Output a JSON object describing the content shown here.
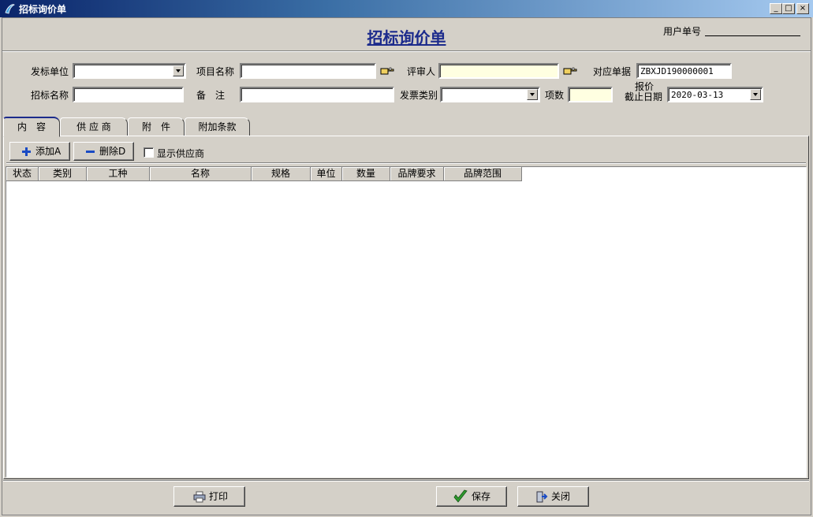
{
  "window": {
    "title": "招标询价单"
  },
  "header": {
    "doc_title": "招标询价单",
    "user_no_label": "用户单号",
    "user_no_value": ""
  },
  "form": {
    "issuer_label": "发标单位",
    "issuer_value": "",
    "project_label": "项目名称",
    "project_value": "",
    "reviewer_label": "评审人",
    "reviewer_value": "",
    "ref_doc_label": "对应单据",
    "ref_doc_value": "ZBXJD190000001",
    "bid_name_label": "招标名称",
    "bid_name_value": "",
    "remark_label": "备　注",
    "remark_value": "",
    "invoice_label": "发票类别",
    "invoice_value": "",
    "item_count_label": "项数",
    "item_count_value": "",
    "deadline_label_top": "报价",
    "deadline_label_bottom": "截止日期",
    "deadline_value": "2020-03-13"
  },
  "tabs": [
    {
      "label": "内　容"
    },
    {
      "label": "供 应 商"
    },
    {
      "label": "附　件"
    },
    {
      "label": "附加条款"
    }
  ],
  "toolbar": {
    "add_label": "添加A",
    "delete_label": "删除D",
    "show_supplier_label": "显示供应商"
  },
  "grid": {
    "columns": [
      "状态",
      "类别",
      "工种",
      "名称",
      "规格",
      "单位",
      "数量",
      "品牌要求",
      "品牌范围"
    ]
  },
  "footer": {
    "print_label": "打印",
    "save_label": "保存",
    "close_label": "关闭"
  },
  "colors": {
    "title_blue": "#1c2b8c",
    "input_yellow": "#ffffe1",
    "face": "#d4d0c8"
  }
}
